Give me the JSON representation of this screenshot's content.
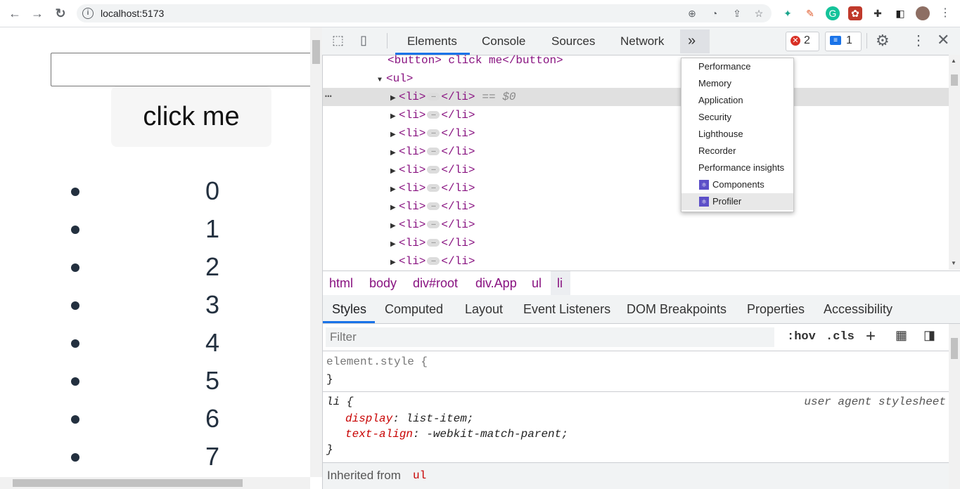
{
  "browser": {
    "url": "localhost:5173",
    "icons": [
      "back-icon",
      "forward-icon",
      "reload-icon",
      "zoom-icon",
      "performance-icon",
      "share-icon",
      "bookmark-star-icon"
    ]
  },
  "page": {
    "input_value": "",
    "button_label": "click me",
    "list_items": [
      "0",
      "1",
      "2",
      "3",
      "4",
      "5",
      "6",
      "7"
    ]
  },
  "devtools": {
    "tabs": [
      "Elements",
      "Console",
      "Sources",
      "Network"
    ],
    "more_tabs_label": "»",
    "error_count": "2",
    "message_count": "1",
    "tree": {
      "button_line": "<button> click me</button>",
      "ul_open": "<ul>",
      "li_open": "<li>",
      "li_close": "</li>",
      "ellipsis": "…",
      "selected_suffix": "== $0",
      "li_count": 10
    },
    "breadcrumbs": [
      "html",
      "body",
      "div#root",
      "div.App",
      "ul",
      "li"
    ],
    "style_tabs": [
      "Styles",
      "Computed",
      "Layout",
      "Event Listeners",
      "DOM Breakpoints",
      "Properties",
      "Accessibility"
    ],
    "filter_placeholder": "Filter",
    "hov_label": ":hov",
    "cls_label": ".cls",
    "styles": {
      "element_style": "element.style {",
      "close_brace": "}",
      "li_selector": "li {",
      "ua_label": "user agent stylesheet",
      "rules": [
        {
          "prop": "display",
          "value": "list-item;"
        },
        {
          "prop": "text-align",
          "value": "-webkit-match-parent;"
        }
      ],
      "inherited_label": "Inherited from",
      "inherited_from": "ul"
    },
    "more_menu": [
      "Performance",
      "Memory",
      "Application",
      "Security",
      "Lighthouse",
      "Recorder",
      "Performance insights",
      "Components",
      "Profiler"
    ]
  },
  "colors": {
    "accent": "#1a73e8",
    "tag": "#881280",
    "error_red": "#d93025"
  }
}
